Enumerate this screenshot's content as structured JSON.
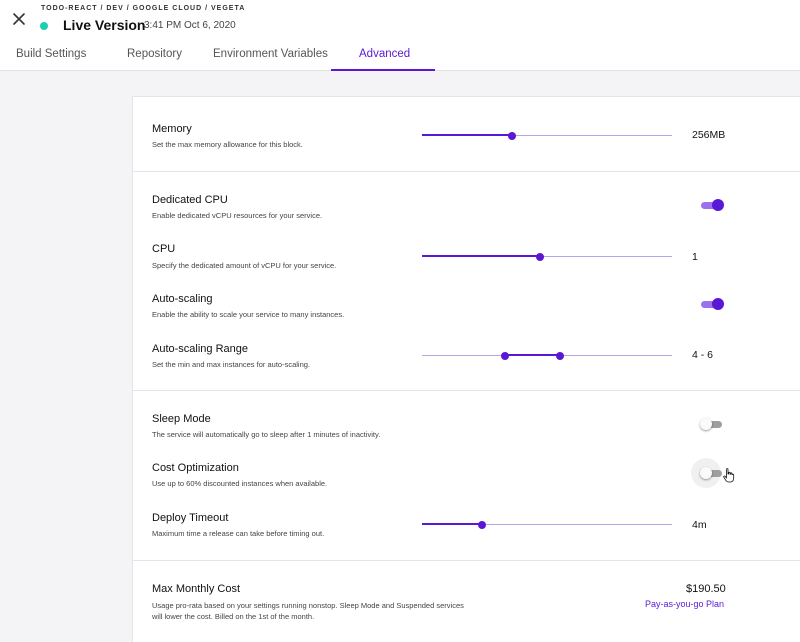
{
  "header": {
    "breadcrumb": "TODO-REACT / DEV / GOOGLE CLOUD / VEGETA",
    "title": "Live Version",
    "timestamp": "3:41 PM Oct 6, 2020",
    "status_color": "#1ccfb0",
    "close_icon": "close-icon"
  },
  "tabs": [
    {
      "label": "Build Settings",
      "active": false
    },
    {
      "label": "Repository",
      "active": false
    },
    {
      "label": "Environment Variables",
      "active": false
    },
    {
      "label": "Advanced",
      "active": true
    }
  ],
  "settings": {
    "memory": {
      "label": "Memory",
      "description": "Set the max memory allowance for this block.",
      "value": "256MB",
      "slider_level": 0.36
    },
    "dedicated_cpu": {
      "label": "Dedicated CPU",
      "description": "Enable dedicated vCPU resources for your service.",
      "enabled": true
    },
    "cpu": {
      "label": "CPU",
      "description": "Specify the dedicated amount of vCPU for your service.",
      "value": "1",
      "slider_level": 0.47
    },
    "auto_scaling": {
      "label": "Auto-scaling",
      "description": "Enable the ability to scale your service to many instances.",
      "enabled": true
    },
    "auto_scaling_range": {
      "label": "Auto-scaling Range",
      "description": "Set the min and max instances for auto-scaling.",
      "value": "4 - 6",
      "range_low": 0.33,
      "range_high": 0.55
    },
    "sleep_mode": {
      "label": "Sleep Mode",
      "description": "The service will automatically go to sleep after 1 minutes of inactivity.",
      "enabled": false
    },
    "cost_optimization": {
      "label": "Cost Optimization",
      "description": "Use up to 60% discounted instances when available.",
      "enabled": false
    },
    "deploy_timeout": {
      "label": "Deploy Timeout",
      "description": "Maximum time a release can take before timing out.",
      "value": "4m",
      "slider_level": 0.24
    }
  },
  "cost": {
    "label": "Max Monthly Cost",
    "description_line1": "Usage pro-rata based on your settings running nonstop. Sleep Mode and Suspended services",
    "description_line2": "will lower the cost. Billed on the 1st of the month.",
    "amount": "$190.50",
    "plan": "Pay-as-you-go Plan"
  },
  "colors": {
    "accent": "#5a18d6",
    "accent_light": "#b8a3ec",
    "toggle_on_track": "#9b72ec"
  }
}
